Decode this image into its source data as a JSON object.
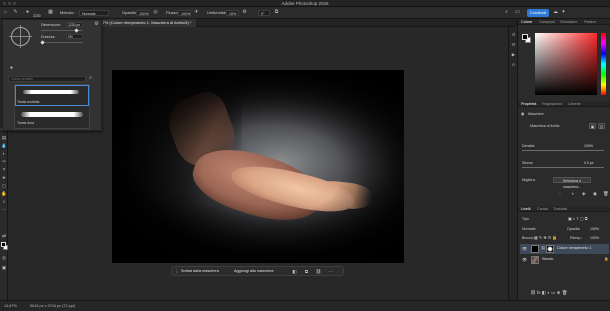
{
  "app": {
    "window_title": "Adobe Photoshop 2026"
  },
  "options_bar": {
    "size_value": "2230",
    "method_label": "Metodo:",
    "method_value": "Normale",
    "opacity_label": "Opacità:",
    "opacity_value": "100%",
    "flow_label": "Flusso:",
    "flow_value": "100%",
    "smoothing_label": "Uniformità:",
    "smoothing_value": "10%",
    "angle_value": "0°",
    "share_button": "Condividi"
  },
  "document": {
    "tab_title": "14,7% (Colore riempimento 1, Maschera di livello/8) *"
  },
  "brush_panel": {
    "dimension_label": "Dimensione:",
    "dimension_value": "2230 px",
    "hardness_label": "Durezza:",
    "hardness_value": "0%",
    "search_placeholder": "Cerca pennelli",
    "brushes": [
      {
        "label": "Tonda morbida"
      },
      {
        "label": "Tonda dura"
      }
    ]
  },
  "context_bar": {
    "subtract_label": "Sottrai dalla maschera",
    "add_label": "Aggiungi alla maschera"
  },
  "right_panel": {
    "color_tabs": [
      "Colore",
      "Campioni",
      "Sfumature",
      "Pattern"
    ],
    "properties_tabs": [
      "Proprietà",
      "Regolazioni",
      "Librerie"
    ],
    "masks_title": "Maschere",
    "mask_type": "Maschera di livello",
    "density_label": "Densità:",
    "density_value": "100%",
    "feather_label": "Sfuma:",
    "feather_value": "0,0 px",
    "refine_label": "Migliora:",
    "select_mask_button": "Seleziona e maschera...",
    "layers_tabs": [
      "Livelli",
      "Canali",
      "Tracciati"
    ],
    "filter_label": "Tipo",
    "blend_mode": "Normale",
    "opacity_short": "Opacità:",
    "opacity_value": "100%",
    "lock_label": "Blocca:",
    "fill_short": "Riemp.:",
    "fill_value": "100%",
    "layers": [
      {
        "name": "Colore riempimento 1"
      },
      {
        "name": "Sfondo"
      }
    ]
  },
  "status_bar": {
    "zoom": "14,67%",
    "doc_info": "5616 px x 3744 px (72 ppi)"
  },
  "colors": {
    "accent": "#2f78d6",
    "foreground": "#000000",
    "background": "#ffffff"
  }
}
